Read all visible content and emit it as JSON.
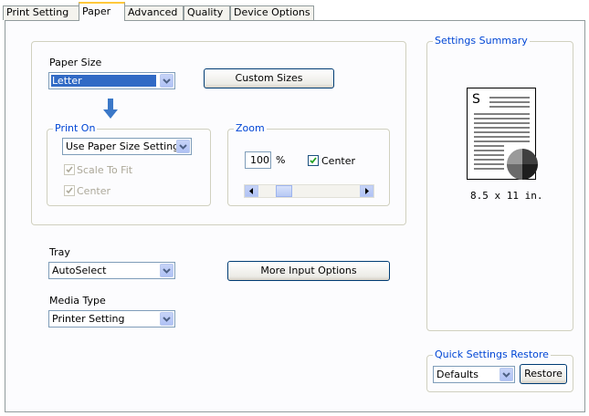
{
  "tabs": [
    {
      "label": "Print Setting"
    },
    {
      "label": "Paper"
    },
    {
      "label": "Advanced"
    },
    {
      "label": "Quality"
    },
    {
      "label": "Device Options"
    }
  ],
  "active_tab": "Paper",
  "paper_size": {
    "label": "Paper Size",
    "value": "Letter"
  },
  "custom_sizes": {
    "label": "Custom Sizes"
  },
  "print_on": {
    "legend": "Print On",
    "value": "Use Paper Size Setting",
    "scale_to_fit": {
      "label": "Scale To Fit",
      "checked": true,
      "enabled": false
    },
    "center": {
      "label": "Center",
      "checked": true,
      "enabled": false
    }
  },
  "zoom": {
    "legend": "Zoom",
    "value": "100",
    "unit": "%",
    "center": {
      "label": "Center",
      "checked": true
    }
  },
  "tray": {
    "label": "Tray",
    "value": "AutoSelect"
  },
  "more_input": {
    "label": "More Input Options"
  },
  "media_type": {
    "label": "Media Type",
    "value": "Printer Setting"
  },
  "summary": {
    "legend": "Settings Summary",
    "page_letter": "S",
    "size_text": "8.5 x 11 in."
  },
  "quick_restore": {
    "legend": "Quick Settings Restore",
    "value": "Defaults",
    "button": "Restore"
  },
  "colors": {
    "accent": "#0046d5",
    "tab_highlight": "#ffc83c",
    "selection": "#316ac5"
  }
}
